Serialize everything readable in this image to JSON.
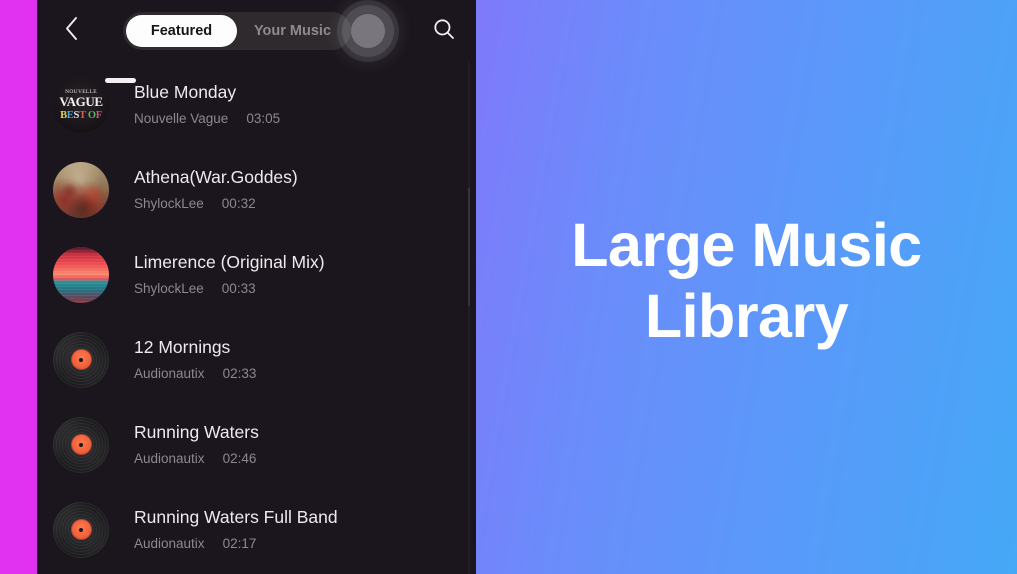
{
  "promo": {
    "line1": "Large Music",
    "line2": "Library",
    "gradient_start": "#a55cf6",
    "gradient_end": "#45a8f7",
    "text_color": "#ffffff"
  },
  "edge_strip": {
    "color": "#e032f0"
  },
  "phone": {
    "background": "#1b161d",
    "header": {
      "back_icon": "chevron-left-icon",
      "search_icon": "search-icon",
      "segmented_control": {
        "track_color": "#2e2a2e",
        "active_pill_color": "#fdfdfd",
        "options": [
          {
            "label": "Featured",
            "active": true
          },
          {
            "label": "Your Music",
            "active": false
          }
        ]
      },
      "touch_indicator": {
        "visible": true,
        "over": "Your Music"
      }
    },
    "sheet_handle": {
      "visible": true
    },
    "tracks": [
      {
        "title": "Blue Monday",
        "artist": "Nouvelle Vague",
        "duration": "03:05",
        "art": "nouvelle-vague-best-of",
        "art_text": {
          "line1": "NOUVELLE",
          "line2": "VAGUE",
          "line3": "BEST OF"
        }
      },
      {
        "title": "Athena(War.Goddes)",
        "artist": "ShylockLee",
        "duration": "00:32",
        "art": "athena-painting"
      },
      {
        "title": "Limerence (Original Mix)",
        "artist": "ShylockLee",
        "duration": "00:33",
        "art": "limerence-sunset"
      },
      {
        "title": "12 Mornings",
        "artist": "Audionautix",
        "duration": "02:33",
        "art": "vinyl-record"
      },
      {
        "title": "Running Waters",
        "artist": "Audionautix",
        "duration": "02:46",
        "art": "vinyl-record"
      },
      {
        "title": "Running Waters Full Band",
        "artist": "Audionautix",
        "duration": "02:17",
        "art": "vinyl-record"
      }
    ]
  }
}
